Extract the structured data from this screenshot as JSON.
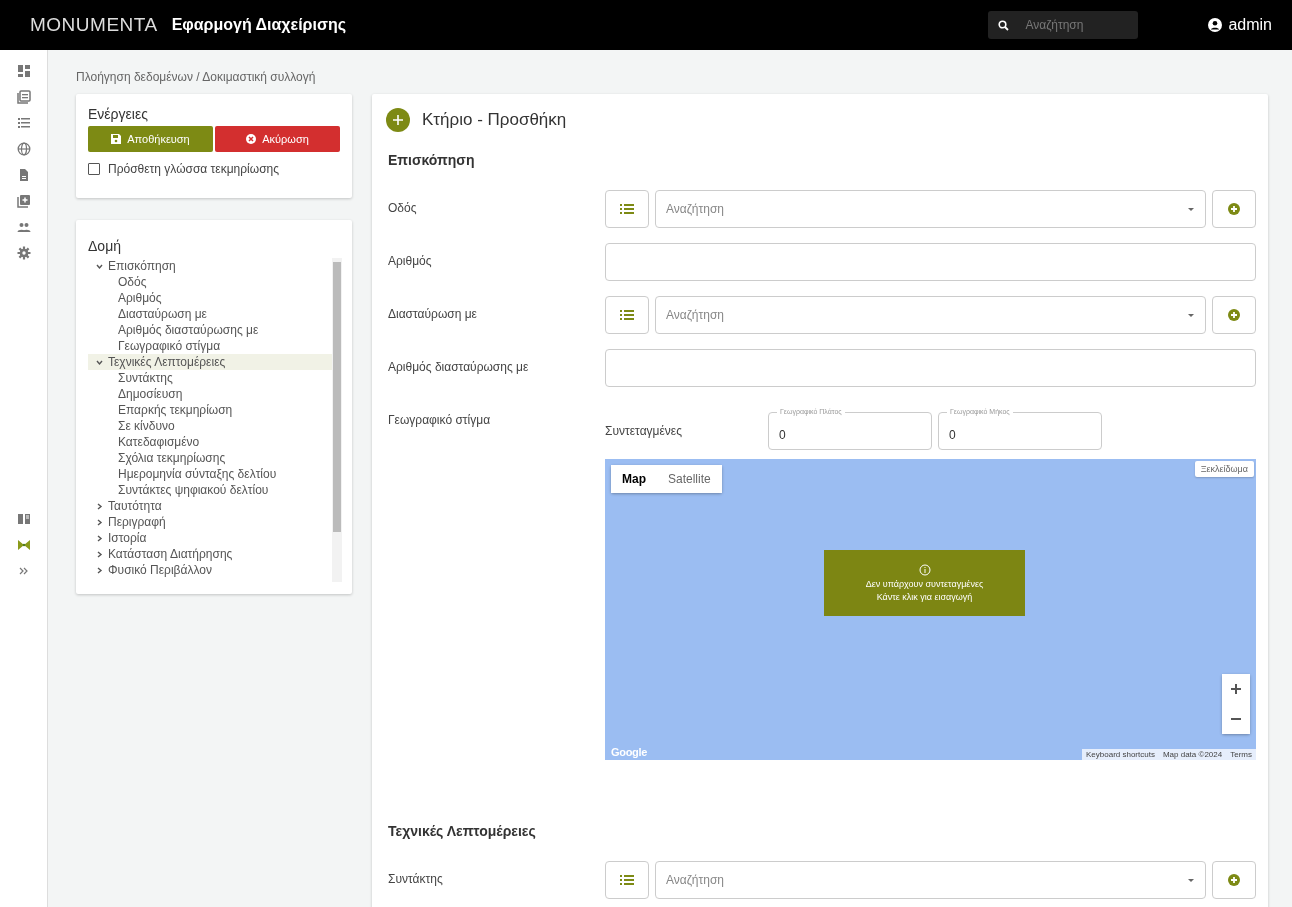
{
  "topbar": {
    "logo": "MONUMENTA",
    "app_title": "Εφαρμογή Διαχείρισης",
    "search": {
      "placeholder": "Αναζήτηση"
    },
    "user": "admin"
  },
  "breadcrumb": "Πλοήγηση δεδομένων / Δοκιμαστική συλλογή",
  "actions": {
    "title": "Ενέργειες",
    "buttons": [
      {
        "label": "Αποθήκευση",
        "kind": "save"
      },
      {
        "label": "Ακύρωση",
        "kind": "cancel"
      }
    ],
    "checkbox": {
      "label": "Πρόσθετη γλώσσα τεκμηρίωσης",
      "checked": false
    }
  },
  "structure": {
    "title": "Δομή",
    "tree": [
      {
        "label": "Επισκόπηση",
        "expanded": true,
        "selected": false,
        "children": [
          {
            "label": "Οδός"
          },
          {
            "label": "Αριθμός"
          },
          {
            "label": "Διασταύρωση με"
          },
          {
            "label": "Αριθμός διασταύρωσης με"
          },
          {
            "label": "Γεωγραφικό στίγμα"
          }
        ]
      },
      {
        "label": "Τεχνικές Λεπτομέρειες",
        "expanded": true,
        "selected": true,
        "children": [
          {
            "label": "Συντάκτης"
          },
          {
            "label": "Δημοσίευση"
          },
          {
            "label": "Επαρκής τεκμηρίωση"
          },
          {
            "label": "Σε κίνδυνο"
          },
          {
            "label": "Κατεδαφισμένο"
          },
          {
            "label": "Σχόλια τεκμηρίωσης"
          },
          {
            "label": "Ημερομηνία σύνταξης δελτίου"
          },
          {
            "label": "Συντάκτες ψηφιακού δελτίου"
          }
        ]
      },
      {
        "label": "Ταυτότητα",
        "expanded": false,
        "selected": false
      },
      {
        "label": "Περιγραφή",
        "expanded": false,
        "selected": false
      },
      {
        "label": "Ιστορία",
        "expanded": false,
        "selected": false
      },
      {
        "label": "Κατάσταση Διατήρησης",
        "expanded": false,
        "selected": false
      },
      {
        "label": "Φυσικό Περιβάλλον",
        "expanded": false,
        "selected": false
      }
    ]
  },
  "form": {
    "title": "Κτήριο - Προσθήκη",
    "sections": [
      {
        "title": "Επισκόπηση",
        "fields": [
          {
            "label": "Οδός",
            "kind": "lookup",
            "placeholder": "Αναζήτηση"
          },
          {
            "label": "Αριθμός",
            "kind": "text"
          },
          {
            "label": "Διασταύρωση με",
            "kind": "lookup",
            "placeholder": "Αναζήτηση"
          },
          {
            "label": "Αριθμός διασταύρωσης με",
            "kind": "text"
          },
          {
            "label": "Γεωγραφικό στίγμα",
            "kind": "geo",
            "coords_label": "Συντεταγμένες",
            "lat": {
              "label": "Γεωγραφικό Πλάτος",
              "value": "0"
            },
            "lng": {
              "label": "Γεωγραφικό Μήκος",
              "value": "0"
            },
            "map": {
              "types": [
                {
                  "label": "Map",
                  "selected": true
                },
                {
                  "label": "Satellite",
                  "selected": false
                }
              ],
              "unlock": "Ξεκλείδωμα",
              "notice": [
                "Δεν υπάρχουν συντεταγμένες",
                "Κάντε κλικ για εισαγωγή"
              ],
              "logo": "Google",
              "attribution": [
                "Keyboard shortcuts",
                "Map data ©2024",
                "Terms"
              ]
            }
          }
        ]
      },
      {
        "title": "Τεχνικές Λεπτομέρειες",
        "fields": [
          {
            "label": "Συντάκτης",
            "kind": "lookup",
            "placeholder": "Αναζήτηση"
          }
        ]
      }
    ]
  }
}
